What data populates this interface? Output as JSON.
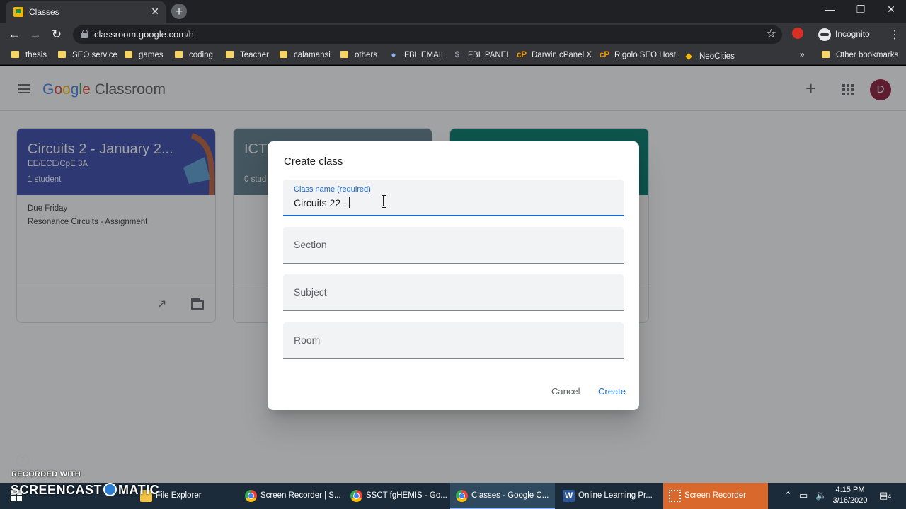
{
  "browser": {
    "tab_title": "Classes",
    "url": "classroom.google.com/h",
    "profile_label": "Incognito",
    "bookmarks": [
      {
        "label": "thesis",
        "icon": "folder-icon"
      },
      {
        "label": "SEO service",
        "icon": "folder-icon"
      },
      {
        "label": "games",
        "icon": "folder-icon"
      },
      {
        "label": "coding",
        "icon": "folder-icon"
      },
      {
        "label": "Teacher",
        "icon": "folder-icon"
      },
      {
        "label": "calamansi",
        "icon": "folder-icon"
      },
      {
        "label": "others",
        "icon": "folder-icon"
      },
      {
        "label": "FBL EMAIL",
        "icon": "globe-icon"
      },
      {
        "label": "FBL PANEL",
        "icon": "dollar-icon"
      },
      {
        "label": "Darwin cPanel X",
        "icon": "cpanel-icon"
      },
      {
        "label": "Rigolo SEO Host",
        "icon": "cpanel-icon"
      },
      {
        "label": "NeoCities",
        "icon": "cat-icon"
      }
    ],
    "other_bookmarks": "Other bookmarks",
    "overflow": "»"
  },
  "app": {
    "brand_google": "Google",
    "brand_product": "Classroom",
    "avatar_initial": "D",
    "help_glyph": "?"
  },
  "cards": [
    {
      "title": "Circuits 2 - January 2...",
      "section": "EE/ECE/CpE 3A",
      "students": "1 student",
      "due": "Due Friday",
      "assignment": "Resonance Circuits - Assignment",
      "color": "#3949ab"
    },
    {
      "title": "ICT",
      "section": "",
      "students": "0 stud",
      "due": "",
      "assignment": "",
      "color": "#607d8b"
    },
    {
      "title": "",
      "section": "",
      "students": "",
      "due": "",
      "assignment": "",
      "color": "#00796b"
    }
  ],
  "dialog": {
    "title": "Create class",
    "class_name_label": "Class name (required)",
    "class_name_value": "Circuits 22 -",
    "section_placeholder": "Section",
    "subject_placeholder": "Subject",
    "room_placeholder": "Room",
    "cancel_label": "Cancel",
    "create_label": "Create"
  },
  "taskbar": {
    "items": [
      {
        "label": "File Explorer",
        "icon": "folder-icon"
      },
      {
        "label": "Screen Recorder | S...",
        "icon": "chrome-icon"
      },
      {
        "label": "SSCT fgHEMIS - Go...",
        "icon": "chrome-icon"
      },
      {
        "label": "Classes - Google C...",
        "icon": "chrome-icon"
      },
      {
        "label": "Online Learning Pr...",
        "icon": "word-icon"
      },
      {
        "label": "Screen Recorder",
        "icon": "recorder-icon"
      }
    ],
    "time": "4:15 PM",
    "date": "3/16/2020",
    "notification_count": "4"
  },
  "watermark": {
    "line1": "RECORDED WITH",
    "line2_a": "SCREENCAST",
    "line2_b": "MATIC"
  },
  "colors": {
    "accent": "#1967d2",
    "avatar": "#8e1a3a",
    "recorder": "#d9682c"
  }
}
